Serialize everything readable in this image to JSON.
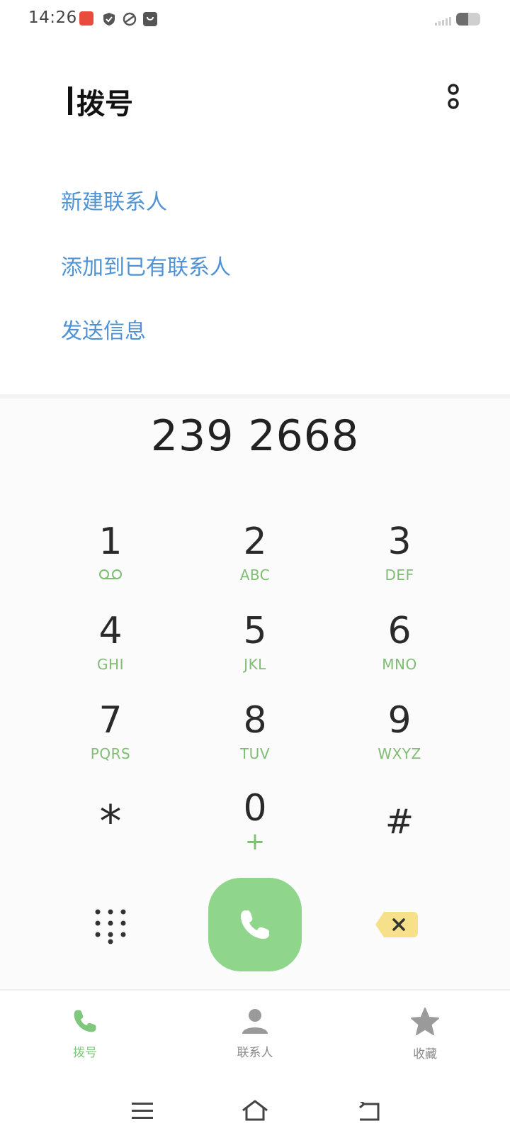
{
  "status_bar": {
    "time": "14:26"
  },
  "header": {
    "title": "拨号"
  },
  "actions": [
    {
      "label": "新建联系人"
    },
    {
      "label": "添加到已有联系人"
    },
    {
      "label": "发送信息"
    }
  ],
  "dialed_number": "239 2668",
  "keys": [
    {
      "digit": "1",
      "sub": ""
    },
    {
      "digit": "2",
      "sub": "ABC"
    },
    {
      "digit": "3",
      "sub": "DEF"
    },
    {
      "digit": "4",
      "sub": "GHI"
    },
    {
      "digit": "5",
      "sub": "JKL"
    },
    {
      "digit": "6",
      "sub": "MNO"
    },
    {
      "digit": "7",
      "sub": "PQRS"
    },
    {
      "digit": "8",
      "sub": "TUV"
    },
    {
      "digit": "9",
      "sub": "WXYZ"
    },
    {
      "digit": "*",
      "sub": ""
    },
    {
      "digit": "0",
      "sub": "+"
    },
    {
      "digit": "#",
      "sub": ""
    }
  ],
  "bottom_tabs": [
    {
      "label": "拨号",
      "icon": "phone-icon",
      "active": true
    },
    {
      "label": "联系人",
      "icon": "person-icon",
      "active": false
    },
    {
      "label": "收藏",
      "icon": "star-icon",
      "active": false
    }
  ],
  "colors": {
    "accent_green": "#8fd68c",
    "link_blue": "#4f93d6",
    "backspace_yellow": "#f7e08a"
  }
}
